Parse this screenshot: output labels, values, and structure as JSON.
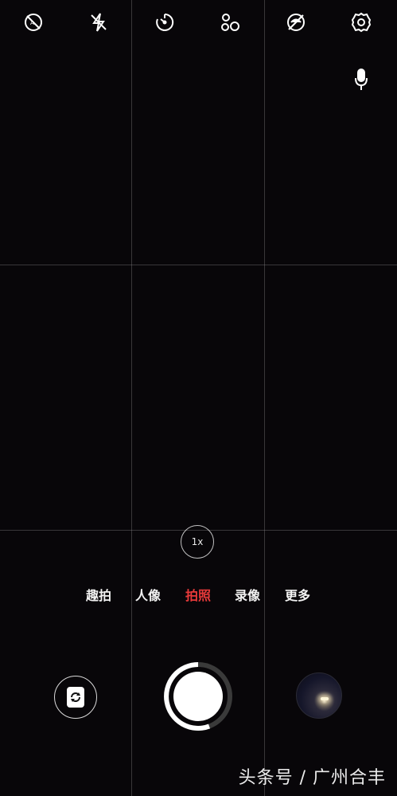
{
  "top_bar": {
    "icons": [
      "hdr-auto-icon",
      "flash-off-icon",
      "timer-icon",
      "filters-icon",
      "beauty-off-icon",
      "settings-icon"
    ]
  },
  "voice": {
    "icon": "microphone-icon"
  },
  "zoom": {
    "label": "1x"
  },
  "modes": {
    "items": [
      {
        "label": "趣拍"
      },
      {
        "label": "人像"
      },
      {
        "label": "拍照"
      },
      {
        "label": "录像"
      },
      {
        "label": "更多"
      }
    ],
    "active_index": 2,
    "active_color": "#e83a3a"
  },
  "controls": {
    "switch_camera_icon": "switch-camera-icon",
    "gallery_icon": "gallery-thumbnail"
  },
  "watermark": {
    "text": "头条号 / 广州合丰"
  }
}
